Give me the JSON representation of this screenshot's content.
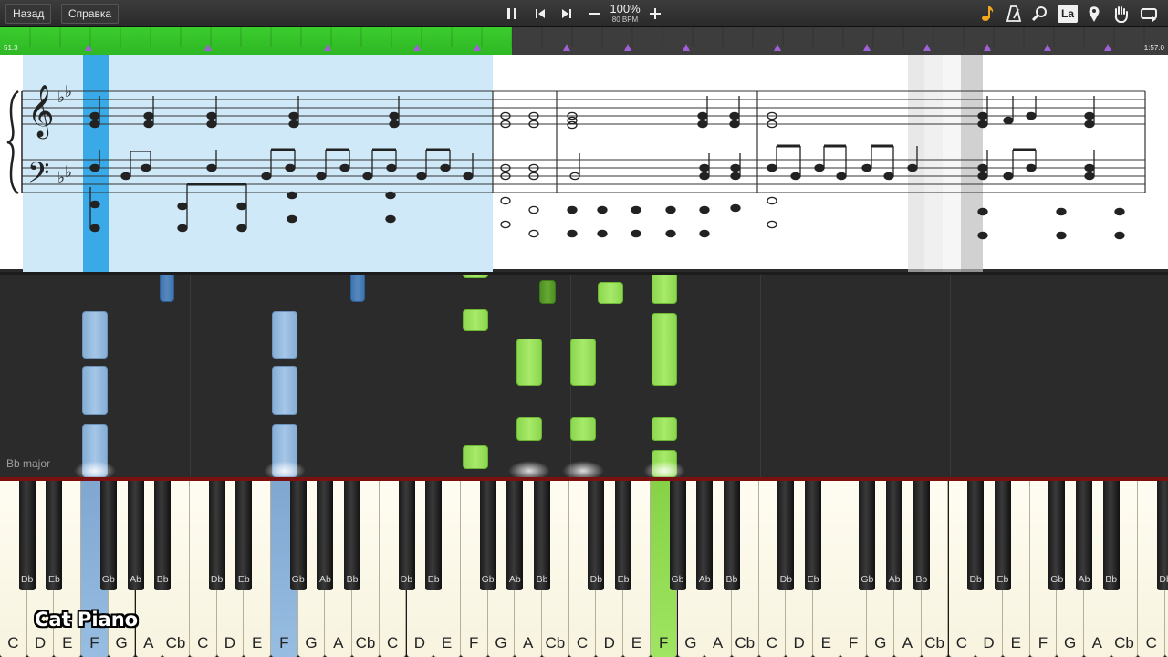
{
  "toolbar": {
    "back_label": "Назад",
    "help_label": "Справка",
    "zoom": "100%",
    "tempo": "80 BPM",
    "note_label_toggle": "La",
    "icons": [
      "pause-icon",
      "previous-icon",
      "next-icon",
      "minus-icon",
      "plus-icon",
      "music-note-icon",
      "metronome-icon",
      "magnifier-icon",
      "note-label-icon",
      "location-pin-icon",
      "hand-icon",
      "loop-icon"
    ]
  },
  "timeline": {
    "start_time": "51.3",
    "end_time": "1:57.0",
    "progress": 0.438,
    "played_color": "#2fb825",
    "marker_color": "#a060d8"
  },
  "roll": {
    "key_signature": "Bb major",
    "left_hand_color": "#8fb5dc",
    "right_hand_color": "#9be45e"
  },
  "keyboard": {
    "white_keys": [
      "C",
      "D",
      "E",
      "F",
      "G",
      "A",
      "Cb",
      "C",
      "D",
      "E",
      "F",
      "G",
      "A",
      "Cb",
      "C",
      "D",
      "E",
      "F",
      "G",
      "A",
      "Cb",
      "C",
      "D",
      "E",
      "F",
      "G",
      "A",
      "Cb",
      "C",
      "D",
      "E",
      "F",
      "G",
      "A",
      "Cb",
      "C",
      "D",
      "E",
      "F",
      "G",
      "A",
      "Cb",
      "C",
      "D",
      "E"
    ],
    "black_keys": [
      "Db",
      "Eb",
      "Gb",
      "Ab",
      "Bb",
      "Db",
      "Eb",
      "Gb",
      "Ab",
      "Bb",
      "Db",
      "Eb",
      "Gb",
      "Ab",
      "Bb",
      "Db",
      "Eb",
      "Gb",
      "Ab",
      "Bb",
      "Db",
      "Eb",
      "Gb",
      "Ab",
      "Bb",
      "Db",
      "Eb",
      "Gb",
      "Ab",
      "Bb",
      "Db"
    ],
    "pressed_blue": [
      "F"
    ],
    "pressed_green": [
      "F"
    ]
  },
  "brand": "Cat Piano"
}
